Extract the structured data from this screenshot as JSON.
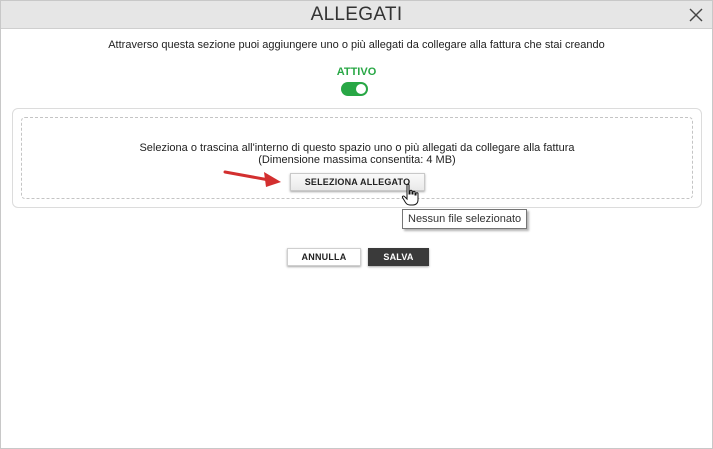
{
  "dialog": {
    "title": "ALLEGATI",
    "close_icon": "close-icon"
  },
  "intro_text": "Attraverso questa sezione puoi aggiungere uno o più allegati da collegare alla fattura che stai creando",
  "toggle": {
    "label": "ATTIVO",
    "state": "on",
    "color": "#28a745"
  },
  "dropzone": {
    "line1": "Seleziona o trascina all'interno di questo spazio uno o più allegati da collegare alla fattura",
    "line2": "(Dimensione massima consentita: 4 MB)",
    "button_label": "SELEZIONA ALLEGATO",
    "tooltip": "Nessun file selezionato"
  },
  "annotation": {
    "arrow_icon": "red-arrow-icon",
    "arrow_color": "#d32f2f",
    "cursor_icon": "hand-pointer-icon"
  },
  "actions": {
    "cancel_label": "ANNULLA",
    "save_label": "SALVA"
  }
}
